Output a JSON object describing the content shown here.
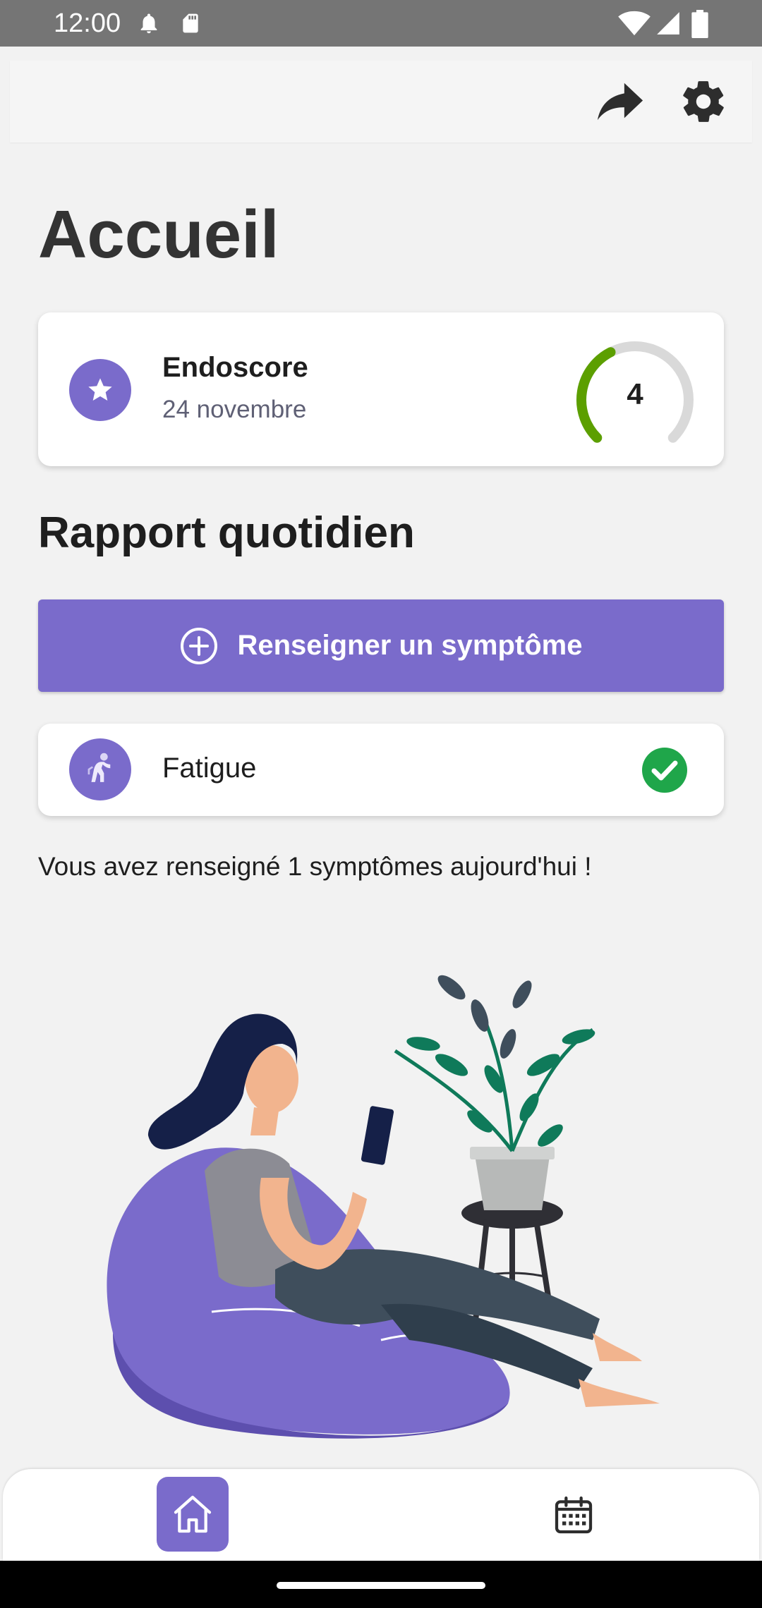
{
  "status_bar": {
    "time": "12:00",
    "icons": [
      "notification-bell-icon",
      "sd-card-icon",
      "wifi-icon",
      "signal-icon",
      "battery-icon"
    ]
  },
  "toolbar": {
    "icons": [
      "share-icon",
      "settings-gear-icon"
    ]
  },
  "page": {
    "title": "Accueil"
  },
  "endoscore_card": {
    "icon": "star-icon",
    "name": "Endoscore",
    "date": "24 novembre",
    "score": "4",
    "gauge_fill_fraction": 0.4,
    "gauge_color": "#5c9f00",
    "gauge_track_color": "#d9d9d9"
  },
  "daily_report": {
    "title": "Rapport quotidien",
    "add_button_label": "Renseigner un symptôme",
    "symptoms": [
      {
        "label": "Fatigue",
        "icon": "fatigue-figure-icon",
        "status": "checked"
      }
    ],
    "summary": "Vous avez renseigné 1 symptômes aujourd'hui !"
  },
  "bottom_nav": {
    "items": [
      {
        "icon": "home-icon",
        "active": true
      },
      {
        "icon": "calendar-icon",
        "active": false
      }
    ]
  },
  "colors": {
    "accent": "#7a6bcb",
    "background": "#f2f2f2",
    "check_green": "#1fa64a",
    "status_bar": "#757575"
  }
}
